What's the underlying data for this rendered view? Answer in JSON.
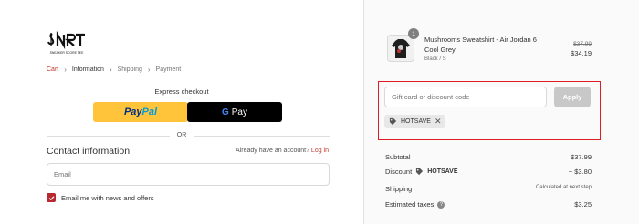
{
  "brand": {
    "logo_text": "$NRT",
    "logo_tagline": "SNEAKER SCORE TEE"
  },
  "breadcrumb": [
    {
      "label": "Cart",
      "state": "link"
    },
    {
      "label": "Information",
      "state": "active"
    },
    {
      "label": "Shipping",
      "state": "inactive"
    },
    {
      "label": "Payment",
      "state": "inactive"
    }
  ],
  "express": {
    "title": "Express checkout",
    "paypal_pay": "Pay",
    "paypal_pal": "Pal",
    "gpay_g": "G",
    "gpay_label": "Pay",
    "or_text": "OR"
  },
  "contact": {
    "title": "Contact information",
    "account_prompt": "Already have an account?",
    "login_label": "Log in",
    "email_placeholder": "Email",
    "newsletter_label": "Email me with news and offers",
    "newsletter_checked": true
  },
  "cart": {
    "item": {
      "quantity": "1",
      "name": "Mushrooms Sweatshirt - Air Jordan 6 Cool Grey",
      "variant": "Black / S",
      "original_price": "$37.99",
      "price": "$34.19"
    }
  },
  "discount": {
    "placeholder": "Gift card or discount code",
    "apply_label": "Apply",
    "applied_code": "HOTSAVE",
    "highlight_color": "#e01b24"
  },
  "summary": {
    "subtotal_label": "Subtotal",
    "subtotal_value": "$37.99",
    "discount_label": "Discount",
    "discount_code": "HOTSAVE",
    "discount_value": "− $3.80",
    "shipping_label": "Shipping",
    "shipping_value": "Calculated at next step",
    "taxes_label": "Estimated taxes",
    "taxes_value": "$3.25"
  },
  "colors": {
    "accent": "#c0392b",
    "paypal_yellow": "#ffc439",
    "gpay_black": "#000000",
    "checkbox": "#b8292f"
  }
}
